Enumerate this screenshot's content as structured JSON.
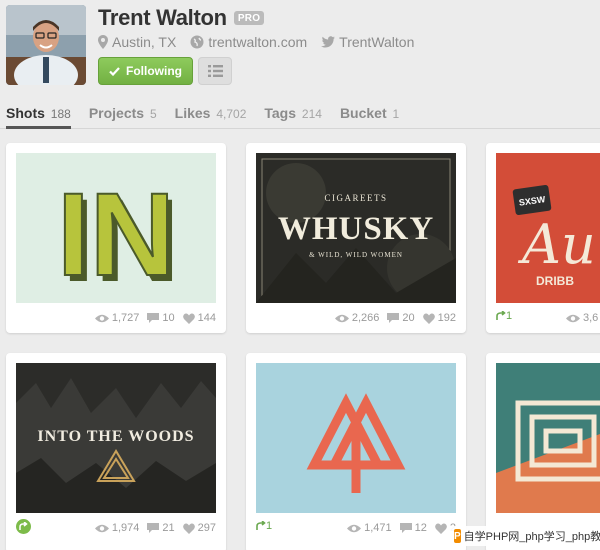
{
  "profile": {
    "name": "Trent Walton",
    "badge": "PRO",
    "location": "Austin, TX",
    "website": "trentwalton.com",
    "twitter": "TrentWalton",
    "follow_label": "Following"
  },
  "tabs": [
    {
      "label": "Shots",
      "count": "188",
      "active": true
    },
    {
      "label": "Projects",
      "count": "5"
    },
    {
      "label": "Likes",
      "count": "4,702"
    },
    {
      "label": "Tags",
      "count": "214"
    },
    {
      "label": "Bucket",
      "count": "1"
    }
  ],
  "shots": [
    {
      "art_text": "IN",
      "views": "1,727",
      "comments": "10",
      "likes": "144"
    },
    {
      "art_top": "CIGAREETS",
      "art_main": "WHUSKY",
      "art_bottom": "& WILD, WILD WOMEN",
      "views": "2,266",
      "comments": "20",
      "likes": "192"
    },
    {
      "art_badge": "SXSW",
      "art_main": "Au",
      "art_sub": "DRIBB",
      "rebounds": "1",
      "views": "3,6"
    },
    {
      "art_text": "INTO THE WOODS",
      "views": "1,974",
      "comments": "21",
      "likes": "297"
    },
    {
      "rebounds": "1",
      "views": "1,471",
      "comments": "12",
      "likes": "2"
    },
    {}
  ],
  "watermark": {
    "logo": "P",
    "text": "自学PHP网_php学习_php教"
  },
  "colors": {
    "follow_green": "#7dbb4a",
    "accent_rebound": "#6aa84f"
  }
}
